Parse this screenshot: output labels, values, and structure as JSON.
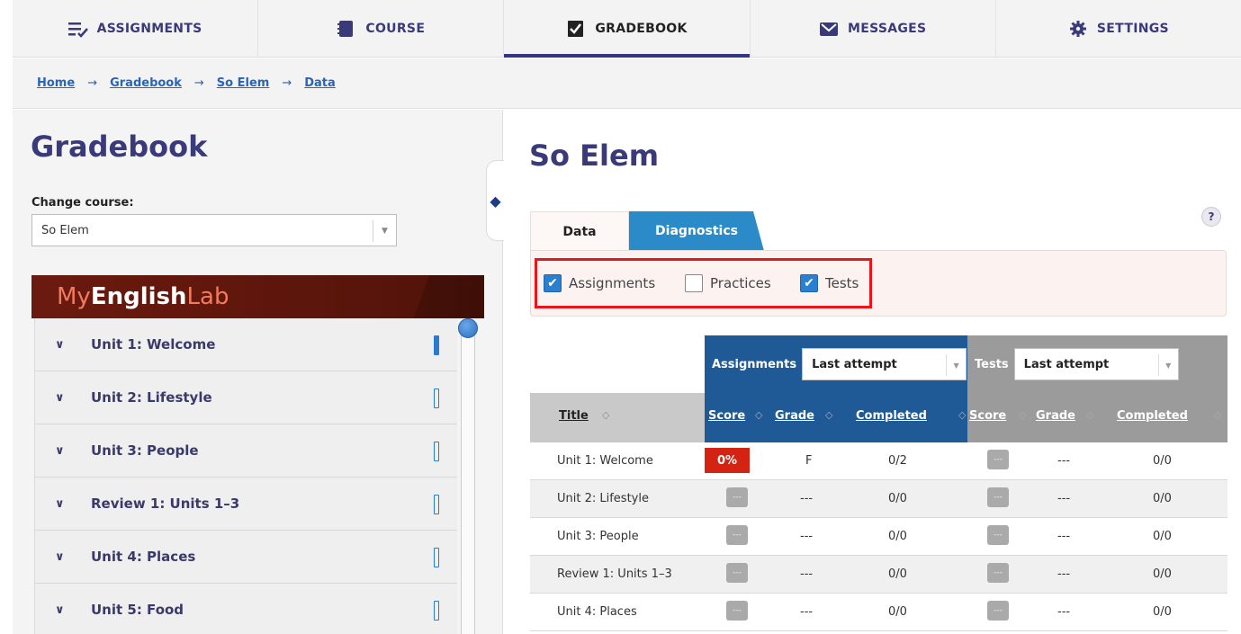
{
  "nav": {
    "tabs": [
      {
        "label": "ASSIGNMENTS",
        "icon": "assignments-icon"
      },
      {
        "label": "COURSE",
        "icon": "course-icon"
      },
      {
        "label": "GRADEBOOK",
        "icon": "gradebook-icon",
        "active": true
      },
      {
        "label": "MESSAGES",
        "icon": "messages-icon"
      },
      {
        "label": "SETTINGS",
        "icon": "settings-icon"
      }
    ]
  },
  "breadcrumb": [
    "Home",
    "Gradebook",
    "So Elem",
    "Data"
  ],
  "breadcrumb_sep": "→",
  "left": {
    "title": "Gradebook",
    "change_course_label": "Change course:",
    "course_select": "So Elem",
    "banner": {
      "my": "My",
      "english": "English",
      "lab": "Lab"
    },
    "units": [
      {
        "label": "Unit 1: Welcome",
        "progress": "filled"
      },
      {
        "label": "Unit 2: Lifestyle",
        "progress": "empty"
      },
      {
        "label": "Unit 3: People",
        "progress": "empty"
      },
      {
        "label": "Review 1: Units 1–3",
        "progress": "empty"
      },
      {
        "label": "Unit 4: Places",
        "progress": "empty"
      },
      {
        "label": "Unit 5: Food",
        "progress": "empty"
      }
    ]
  },
  "main": {
    "title": "So Elem",
    "help": "?",
    "tabs": {
      "data": "Data",
      "diagnostics": "Diagnostics"
    },
    "filters": [
      {
        "label": "Assignments",
        "checked": true
      },
      {
        "label": "Practices",
        "checked": false
      },
      {
        "label": "Tests",
        "checked": true
      }
    ],
    "table": {
      "assignments_group": "Assignments",
      "assignments_select": "Last attempt",
      "tests_group": "Tests",
      "tests_select": "Last attempt",
      "columns": {
        "title": "Title",
        "score": "Score",
        "grade": "Grade",
        "completed": "Completed"
      },
      "rows": [
        {
          "title": "Unit 1: Welcome",
          "a_score": "0%",
          "a_grade": "F",
          "a_completed": "0/2",
          "t_score": "---",
          "t_grade": "---",
          "t_completed": "0/0"
        },
        {
          "title": "Unit 2: Lifestyle",
          "a_score": "---",
          "a_grade": "---",
          "a_completed": "0/0",
          "t_score": "---",
          "t_grade": "---",
          "t_completed": "0/0"
        },
        {
          "title": "Unit 3: People",
          "a_score": "---",
          "a_grade": "---",
          "a_completed": "0/0",
          "t_score": "---",
          "t_grade": "---",
          "t_completed": "0/0"
        },
        {
          "title": "Review 1: Units 1–3",
          "a_score": "---",
          "a_grade": "---",
          "a_completed": "0/0",
          "t_score": "---",
          "t_grade": "---",
          "t_completed": "0/0"
        },
        {
          "title": "Unit 4: Places",
          "a_score": "---",
          "a_grade": "---",
          "a_completed": "0/0",
          "t_score": "---",
          "t_grade": "---",
          "t_completed": "0/0"
        }
      ]
    }
  },
  "colors": {
    "accent": "#353585",
    "brand_banner": "#5a150b",
    "tab_blue": "#2b8bc8",
    "assign_header": "#1f5a96",
    "test_header": "#9b9b9b",
    "alert": "#d42313",
    "highlight_frame": "#e8161b"
  }
}
